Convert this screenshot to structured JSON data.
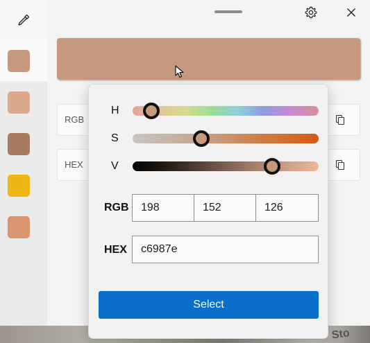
{
  "preview_color": "#c6987e",
  "palette": [
    {
      "color": "#c6987e"
    },
    {
      "color": "#dba98b"
    },
    {
      "color": "#a97a62"
    },
    {
      "color": "#eeb613"
    },
    {
      "color": "#d9966e"
    }
  ],
  "formats": [
    {
      "label": "RGB"
    },
    {
      "label": "HEX"
    }
  ],
  "editor": {
    "sliders": [
      {
        "label": "H",
        "fraction": 0.1
      },
      {
        "label": "S",
        "fraction": 0.37
      },
      {
        "label": "V",
        "fraction": 0.75
      }
    ],
    "rgb": {
      "label": "RGB",
      "r": "198",
      "g": "152",
      "b": "126"
    },
    "hex": {
      "label": "HEX",
      "value": "c6987e"
    },
    "select_label": "Select"
  },
  "icons": {
    "picker": "eyedropper-icon",
    "settings": "gear-icon",
    "close": "close-icon",
    "copy": "copy-icon"
  },
  "backdrop_text": "Sto"
}
